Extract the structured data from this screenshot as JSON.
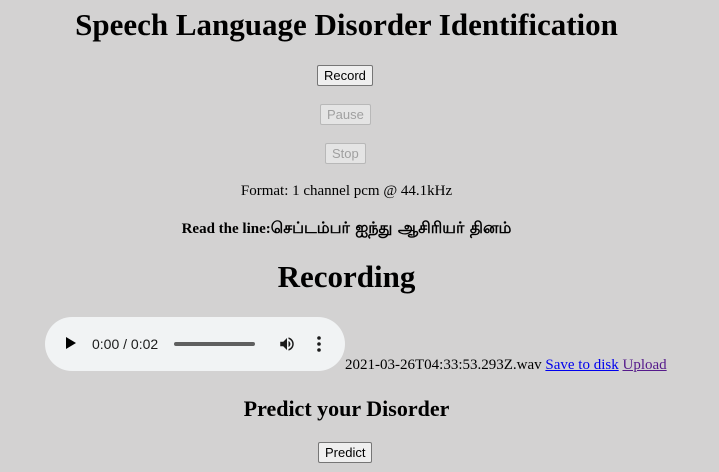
{
  "page": {
    "title": "Speech Language Disorder Identification"
  },
  "controls": {
    "record_label": "Record",
    "pause_label": "Pause",
    "stop_label": "Stop"
  },
  "format_text": "Format: 1 channel pcm @ 44.1kHz",
  "read_line": {
    "label": "Read the line:",
    "text": "செப்டம்பர் ஐந்து ஆசிரியர் தினம்"
  },
  "recording": {
    "heading": "Recording",
    "player": {
      "time_display": "0:00 / 0:02",
      "progress": 0
    },
    "filename": "2021-03-26T04:33:53.293Z.wav",
    "save_link": "Save to disk",
    "upload_link": "Upload"
  },
  "predict": {
    "heading": "Predict your Disorder",
    "button_label": "Predict"
  },
  "icons": {
    "play": "play-icon",
    "volume": "volume-icon",
    "menu": "more-vert-icon"
  }
}
